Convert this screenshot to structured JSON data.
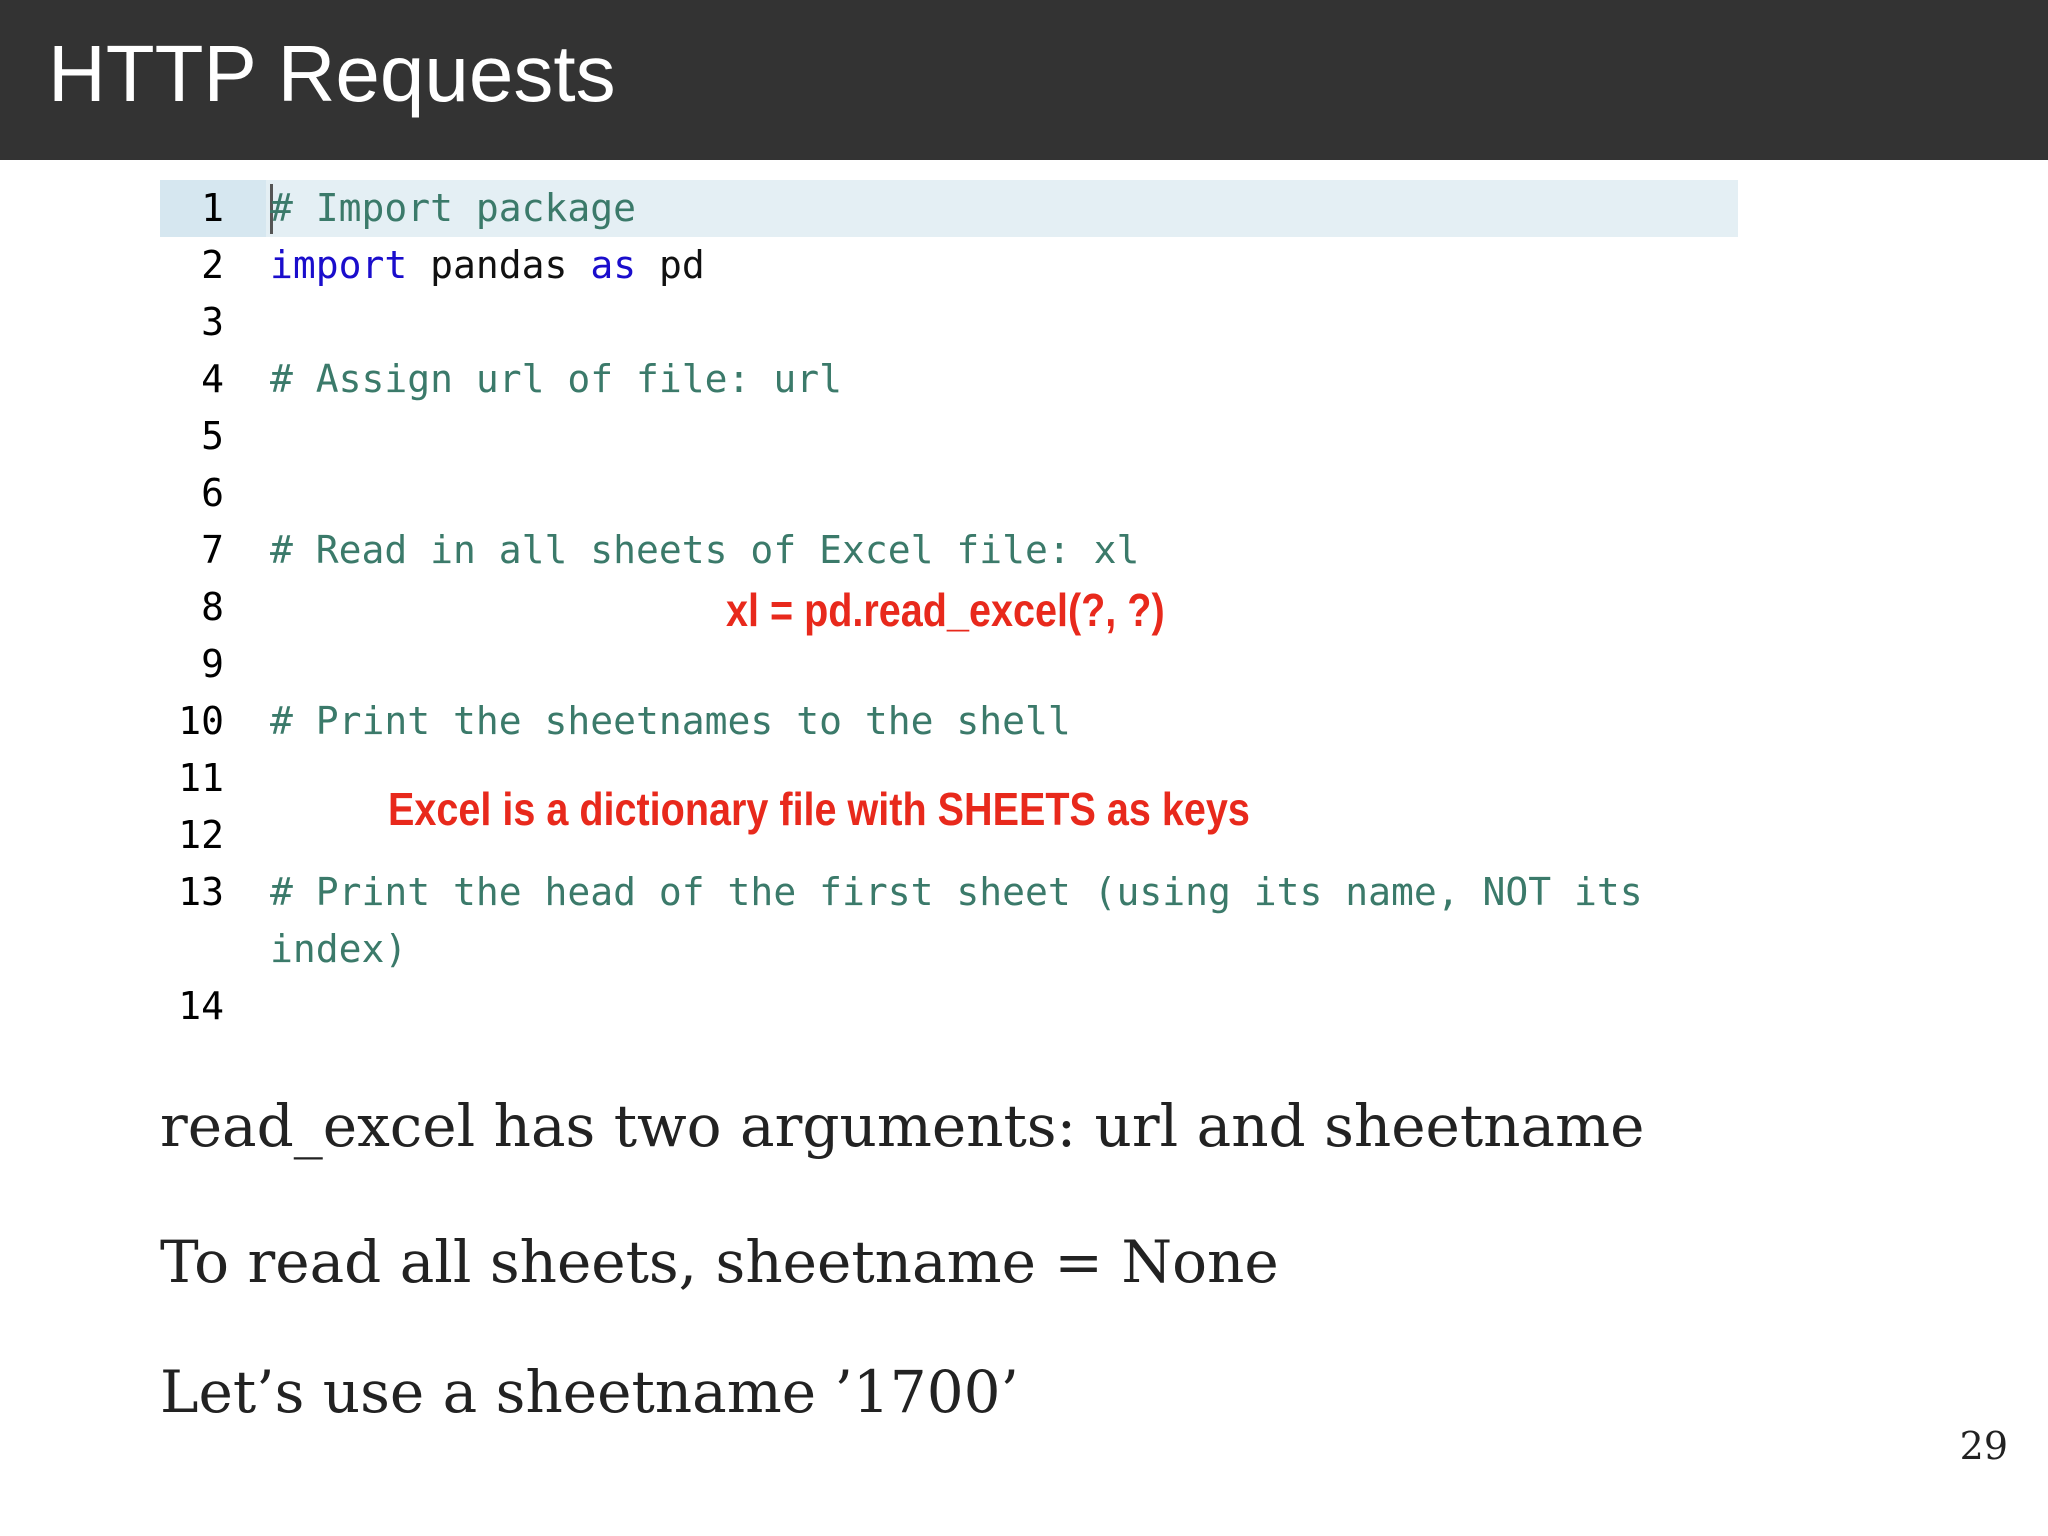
{
  "slide": {
    "title": "HTTP Requests",
    "page_number": "29"
  },
  "code": {
    "lines": [
      {
        "num": "1",
        "comment": "# Import package"
      },
      {
        "num": "2",
        "kw1": "import",
        "name1": " pandas ",
        "kw2": "as",
        "name2": " pd"
      },
      {
        "num": "3"
      },
      {
        "num": "4",
        "comment": "# Assign url of file: url"
      },
      {
        "num": "5"
      },
      {
        "num": "6"
      },
      {
        "num": "7",
        "comment": "# Read in all sheets of Excel file: xl"
      },
      {
        "num": "8"
      },
      {
        "num": "9"
      },
      {
        "num": "10",
        "comment": "# Print the sheetnames to the shell"
      },
      {
        "num": "11"
      },
      {
        "num": "12"
      },
      {
        "num": "13",
        "comment": "# Print the head of the first sheet (using its name, NOT its",
        "comment_cont": "index)"
      },
      {
        "num": "14"
      }
    ]
  },
  "annotations": {
    "read_excel_hint": "xl = pd.read_excel(?, ?)",
    "dictionary_note": "Excel is a dictionary file with SHEETS as keys"
  },
  "body": {
    "line1": "read_excel has two arguments:  url and sheetname",
    "line2": "To read all sheets, sheetname = None",
    "line3": "Let’s use a sheetname ’1700’"
  },
  "colors": {
    "title_bar": "#333333",
    "comment": "#3b7a6a",
    "keyword": "#1a0dcc",
    "annotation": "#e8291c",
    "highlight": "#e4eff4"
  }
}
